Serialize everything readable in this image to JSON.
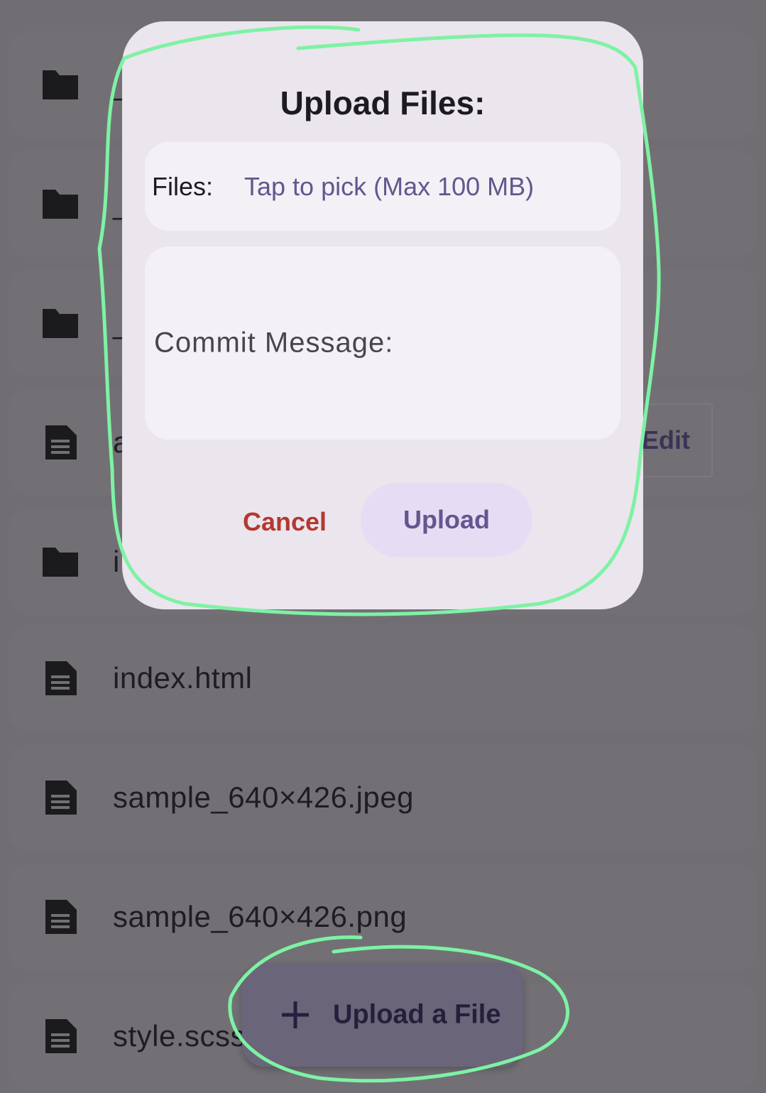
{
  "file_list": {
    "items": [
      {
        "type": "folder",
        "name": "_"
      },
      {
        "type": "folder",
        "name": "_"
      },
      {
        "type": "folder",
        "name": "_"
      },
      {
        "type": "file",
        "name": "a"
      },
      {
        "type": "folder",
        "name": "i"
      },
      {
        "type": "file",
        "name": "index.html"
      },
      {
        "type": "file",
        "name": "sample_640×426.jpeg"
      },
      {
        "type": "file",
        "name": "sample_640×426.png"
      },
      {
        "type": "file",
        "name": "style.scss"
      }
    ],
    "edit_label": "Edit"
  },
  "dialog": {
    "title": "Upload Files:",
    "files_label": "Files:",
    "files_placeholder": "Tap to pick (Max 100 MB)",
    "commit_label": "Commit Message:",
    "cancel_label": "Cancel",
    "upload_label": "Upload"
  },
  "fab": {
    "label": "Upload a File",
    "icon": "plus-icon"
  },
  "icons": {
    "folder": "folder-icon",
    "file": "file-icon"
  },
  "colors": {
    "scrim": "#706e73",
    "dialog_bg": "#ebe5ee",
    "accent": "#65558f",
    "cancel": "#b3382e",
    "annotation": "#7ef2a4"
  }
}
